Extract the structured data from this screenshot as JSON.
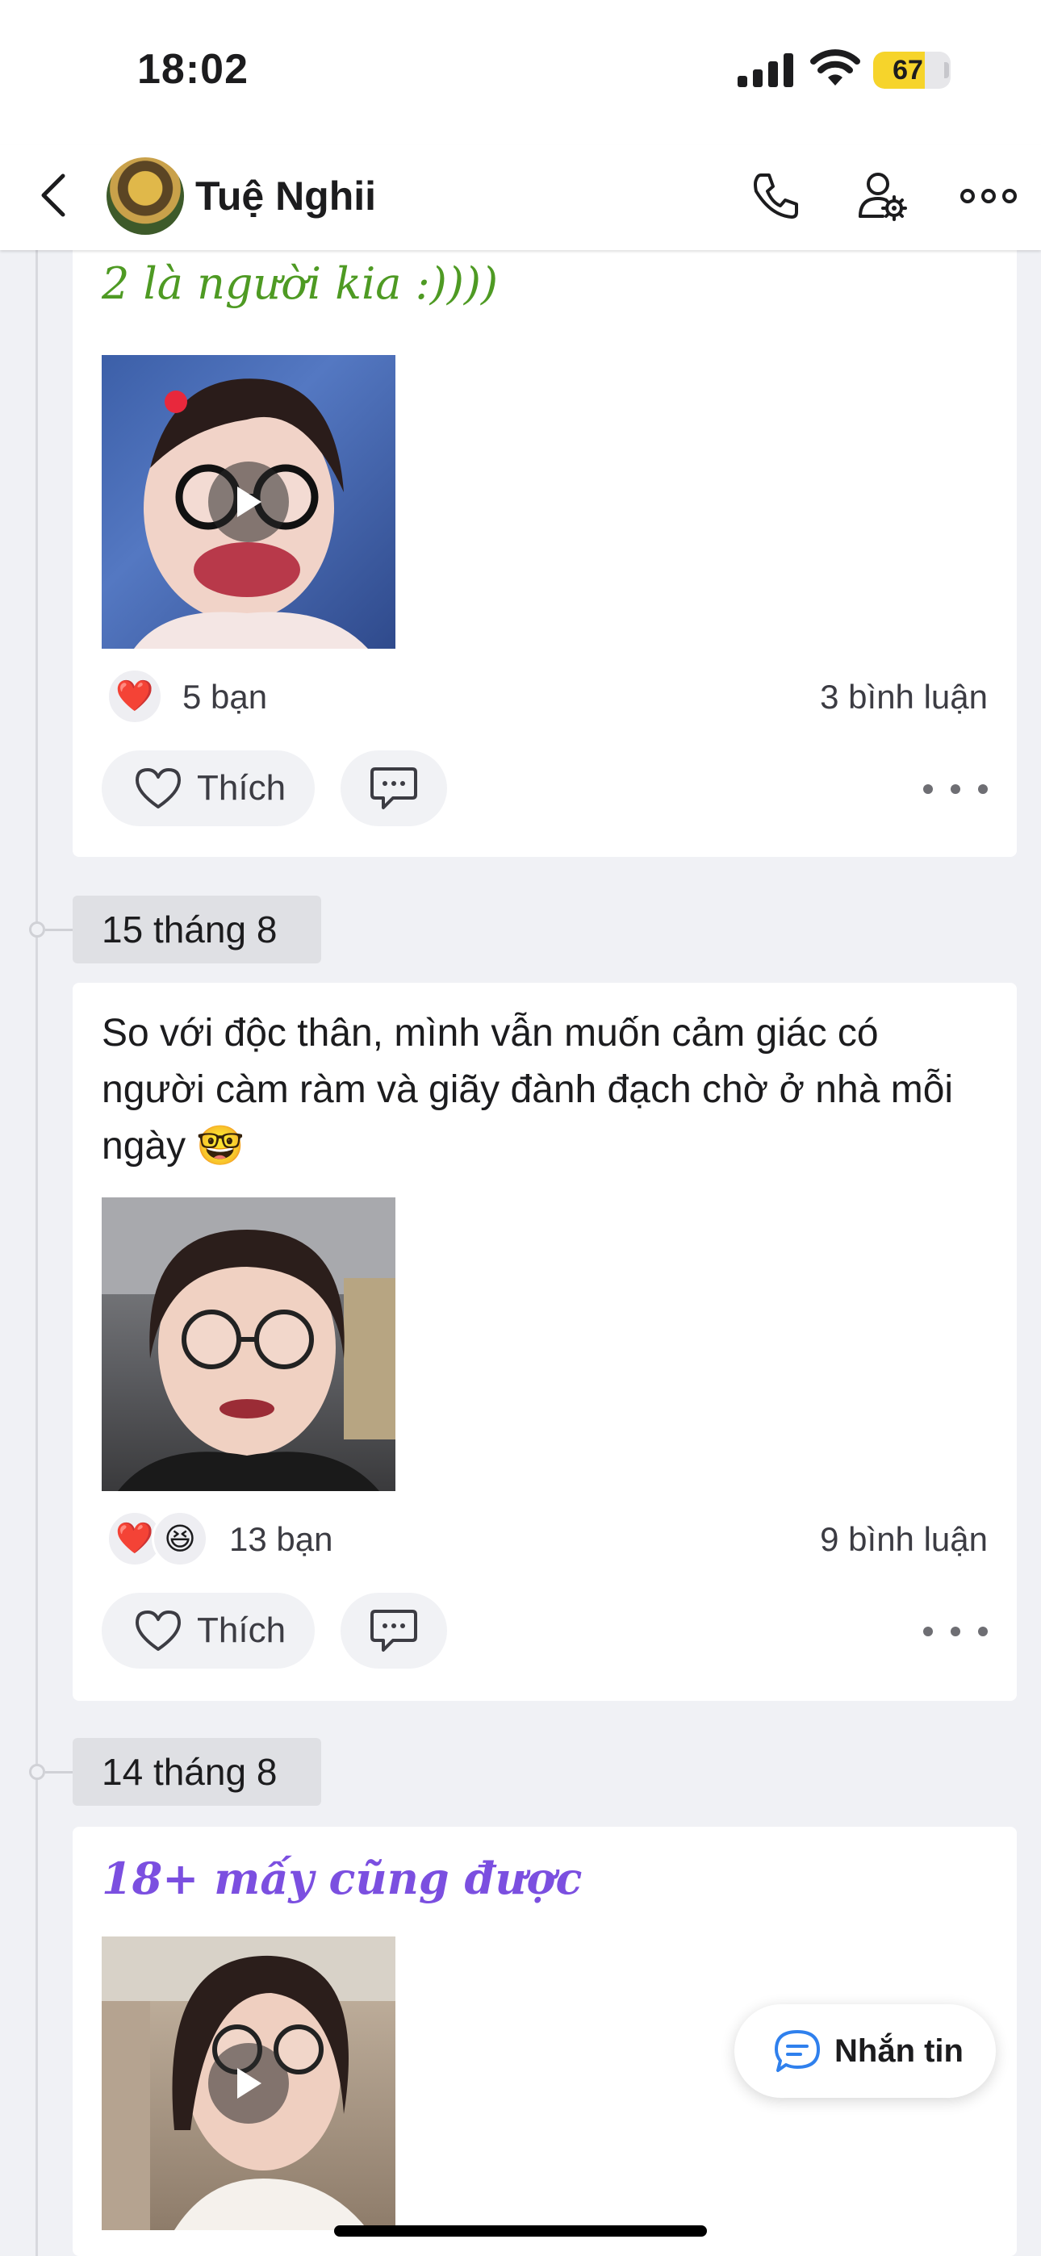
{
  "status_bar": {
    "time": "18:02",
    "battery": "67",
    "battery_level": 0.67
  },
  "header": {
    "name": "Tuệ Nghii",
    "icons": [
      "back-chevron-icon",
      "phone-icon",
      "user-settings-icon",
      "more-horizontal-icon"
    ]
  },
  "posts": [
    {
      "caption": "2 là người kia :))))",
      "caption_color": "#4e9a23",
      "media_type": "video",
      "reactions": [
        "❤️"
      ],
      "reaction_count": "5 bạn",
      "comment_count": "3 bình luận",
      "like_label": "Thích"
    },
    {
      "date": "15 tháng 8",
      "text": "So với độc thân, mình vẫn muốn cảm giác có người càm ràm và giãy đành đạch chờ ở nhà mỗi ngày 🤓",
      "media_type": "photo",
      "reactions": [
        "❤️",
        "😆"
      ],
      "reaction_count": "13 bạn",
      "comment_count": "9 bình luận",
      "like_label": "Thích"
    },
    {
      "date": "14 tháng 8",
      "caption": "18+ mấy cũng được",
      "caption_color": "#7b4fe0",
      "media_type": "video"
    }
  ],
  "fab": {
    "label": "Nhắn tin"
  },
  "colors": {
    "accent_blue": "#2f80ed",
    "heart_red": "#e8283c",
    "battery_yellow": "#f6d42b"
  }
}
